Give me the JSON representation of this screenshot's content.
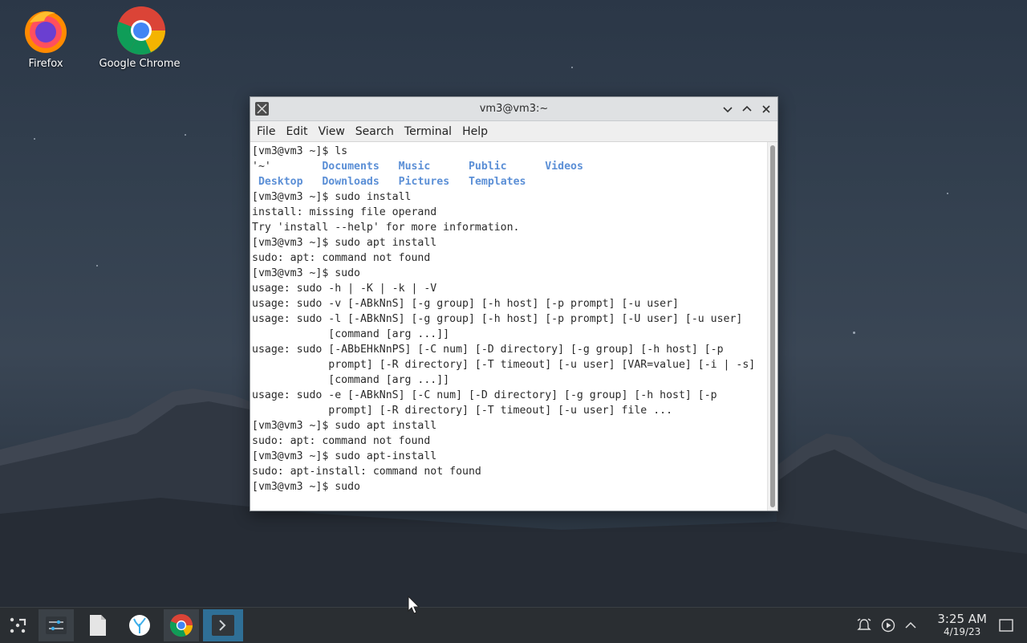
{
  "desktop": {
    "icons": [
      {
        "label": "Firefox",
        "icon": "firefox-icon"
      },
      {
        "label": "Google Chrome",
        "icon": "chrome-icon"
      }
    ]
  },
  "window": {
    "title": "vm3@vm3:~",
    "menu": [
      "File",
      "Edit",
      "View",
      "Search",
      "Terminal",
      "Help"
    ]
  },
  "terminal": {
    "lines": [
      "[vm3@vm3 ~]$ ls",
      "'~'        Documents   Music      Public      Videos",
      " Desktop   Downloads   Pictures   Templates",
      "[vm3@vm3 ~]$ sudo install",
      "install: missing file operand",
      "Try 'install --help' for more information.",
      "[vm3@vm3 ~]$ sudo apt install",
      "sudo: apt: command not found",
      "[vm3@vm3 ~]$ sudo",
      "usage: sudo -h | -K | -k | -V",
      "usage: sudo -v [-ABkNnS] [-g group] [-h host] [-p prompt] [-u user]",
      "usage: sudo -l [-ABkNnS] [-g group] [-h host] [-p prompt] [-U user] [-u user]",
      "            [command [arg ...]]",
      "usage: sudo [-ABbEHkNnPS] [-C num] [-D directory] [-g group] [-h host] [-p",
      "            prompt] [-R directory] [-T timeout] [-u user] [VAR=value] [-i | -s]",
      "            [command [arg ...]]",
      "usage: sudo -e [-ABkNnS] [-C num] [-D directory] [-g group] [-h host] [-p",
      "            prompt] [-R directory] [-T timeout] [-u user] file ...",
      "[vm3@vm3 ~]$ sudo apt install",
      "sudo: apt: command not found",
      "[vm3@vm3 ~]$ sudo apt-install",
      "sudo: apt-install: command not found",
      "[vm3@vm3 ~]$ sudo"
    ],
    "ls_dirs_row1": [
      "'~'",
      "Documents",
      "Music",
      "Public",
      "Videos"
    ],
    "ls_dirs_row2": [
      "Desktop",
      "Downloads",
      "Pictures",
      "Templates"
    ]
  },
  "taskbar": {
    "clock_time": "3:25 AM",
    "clock_date": "4/19/23"
  },
  "colors": {
    "dir_blue": "#5b8fd6",
    "taskbar_bg": "#2a2e32",
    "terminal_active": "#2f6f96"
  }
}
